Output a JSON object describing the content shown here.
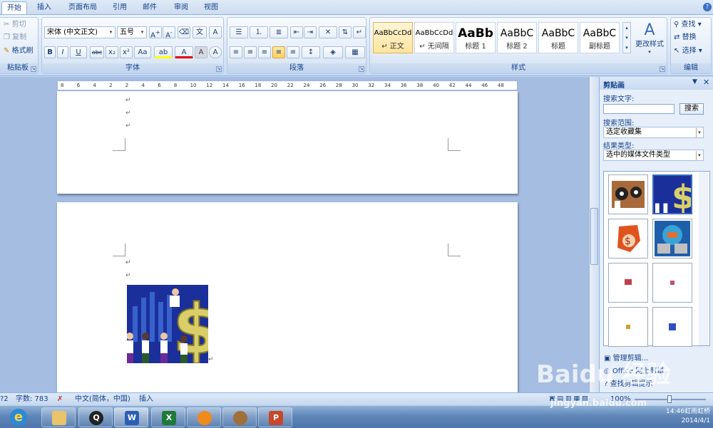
{
  "tabs": [
    "开始",
    "插入",
    "页面布局",
    "引用",
    "邮件",
    "审阅",
    "视图"
  ],
  "clipboard": {
    "cut": "剪切",
    "copy": "复制",
    "format_painter": "格式刷",
    "label": "粘贴板"
  },
  "font": {
    "name": "宋体 (中文正文)",
    "size": "五号",
    "label": "字体",
    "buttons": [
      "B",
      "I",
      "U",
      "abc",
      "x₂",
      "x²",
      "Aa",
      "ab",
      "A",
      "A",
      "A"
    ]
  },
  "paragraph": {
    "label": "段落"
  },
  "styles": {
    "label": "样式",
    "items": [
      {
        "preview": "AaBbCcDd",
        "name": "↵ 正文"
      },
      {
        "preview": "AaBbCcDd",
        "name": "↵ 无间隔"
      },
      {
        "preview": "AaBb",
        "name": "标题 1"
      },
      {
        "preview": "AaBbC",
        "name": "标题 2"
      },
      {
        "preview": "AaBbC",
        "name": "标题"
      },
      {
        "preview": "AaBbC",
        "name": "副标题"
      }
    ],
    "change": "更改样式"
  },
  "editing": {
    "label": "编辑",
    "find": "查找",
    "replace": "替换",
    "select": "选择"
  },
  "ruler_ticks": [
    "8",
    "6",
    "4",
    "2",
    "2",
    "4",
    "6",
    "8",
    "10",
    "12",
    "14",
    "16",
    "18",
    "20",
    "22",
    "24",
    "26",
    "28",
    "30",
    "32",
    "34",
    "36",
    "38",
    "40",
    "42",
    "44",
    "46",
    "48"
  ],
  "clip_pane": {
    "title": "剪贴画",
    "search_label": "搜索文字:",
    "search_value": "",
    "search_button": "搜索",
    "scope_label": "搜索范围:",
    "scope_value": "选定收藏集",
    "type_label": "结果类型:",
    "type_value": "选中的媒体文件类型",
    "links": [
      "管理剪辑...",
      "Office 网上剪辑",
      "查找剪辑提示"
    ]
  },
  "status": {
    "page": "?2",
    "words": "字数: 783",
    "lang": "中文(简体，中国)",
    "mode": "插入",
    "zoom": "100%"
  },
  "clock": {
    "time": "14:46",
    "date": "2014/4/1"
  },
  "tray_text": "虹雨虹桥",
  "watermark": {
    "brand": "Baidu 经验",
    "url": "jingyan.baidu.com"
  },
  "colors": {
    "accent": "#15428b",
    "ribbon": "#dbe7f6",
    "selected_style": "#ffe49c",
    "doc_bg": "#a4bde1"
  }
}
